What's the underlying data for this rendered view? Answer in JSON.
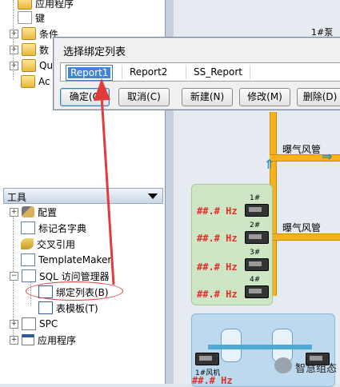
{
  "explorer": {
    "top_items": [
      {
        "label": "应用程序",
        "icon": "application-folder-icon",
        "expandable": false
      },
      {
        "label": "键",
        "icon": "key-icon",
        "expandable": false
      },
      {
        "label": "条件",
        "icon": "conditions-folder-icon",
        "expandable": true
      },
      {
        "label": "数",
        "icon": "data-folder-icon",
        "expandable": true
      },
      {
        "label": "Qu",
        "icon": "query-folder-icon",
        "expandable": true
      },
      {
        "label": "Ac",
        "icon": "action-icon",
        "expandable": false
      }
    ],
    "tools_header": "工具",
    "tools_items": [
      {
        "label": "配置",
        "icon": "wrench-icon",
        "expandable": true
      },
      {
        "label": "标记名字典",
        "icon": "dictionary-icon",
        "expandable": false
      },
      {
        "label": "交叉引用",
        "icon": "cross-reference-icon",
        "expandable": false
      },
      {
        "label": "TemplateMaker",
        "icon": "template-maker-icon",
        "expandable": false
      },
      {
        "label": "SQL 访问管理器",
        "icon": "sql-access-icon",
        "expandable": true,
        "expanded": true
      },
      {
        "label": "绑定列表(B)",
        "icon": "bind-list-icon",
        "expandable": false,
        "child": true
      },
      {
        "label": "表模板(T)",
        "icon": "table-template-icon",
        "expandable": false,
        "child": true
      },
      {
        "label": "SPC",
        "icon": "spc-icon",
        "expandable": true
      },
      {
        "label": "应用程序",
        "icon": "application-icon",
        "expandable": true
      }
    ]
  },
  "dialog": {
    "title": "选择绑定列表",
    "list_items": [
      "Report1",
      "Report2",
      "SS_Report"
    ],
    "selected": "Report1",
    "buttons": {
      "ok": "确定(O",
      "cancel": "取消(C)",
      "new": "新建(N)",
      "modify": "修改(M)",
      "delete": "删除(D)"
    }
  },
  "canvas": {
    "top_label": "1#泵",
    "pipe_labels": [
      "曝气风管",
      "曝气风管"
    ],
    "hz_labels": [
      "##.# Hz",
      "##.# Hz",
      "##.# Hz",
      "##.# Hz",
      "##.# Hz"
    ],
    "motor_labels": [
      "1#",
      "2#",
      "3#",
      "4#"
    ],
    "fan_label": "1#风机",
    "colors": {
      "pipe": "#f3b21e",
      "hz_text": "#e2302e",
      "blue_pipe": "#4fa9d6",
      "panel_green": "#cfe6c4"
    }
  },
  "watermark": "智慧组态",
  "annotation_color": "#e23b3b"
}
